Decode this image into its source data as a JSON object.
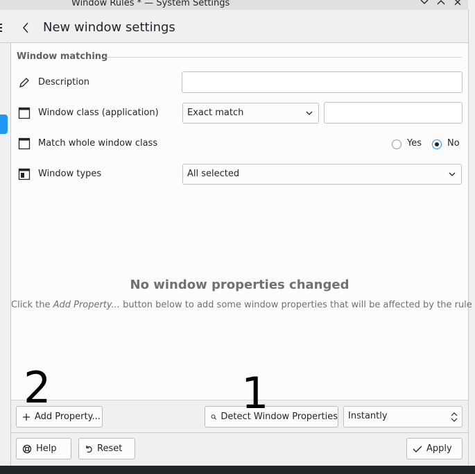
{
  "window": {
    "title": "Window Rules * — System Settings",
    "minimize_icon": "chevron-down-icon",
    "maximize_icon": "chevron-up-icon",
    "close_icon": "close-icon"
  },
  "header": {
    "title": "New window settings"
  },
  "section": {
    "heading": "Window matching"
  },
  "rows": {
    "description": {
      "label": "Description",
      "value": ""
    },
    "window_class": {
      "label": "Window class (application)",
      "match_type": "Exact match",
      "value": ""
    },
    "whole_class": {
      "label": "Match whole window class",
      "yes": "Yes",
      "no": "No",
      "selected": "No"
    },
    "window_types": {
      "label": "Window types",
      "value": "All selected"
    }
  },
  "empty_state": {
    "title": "No window properties changed",
    "desc_before": "Click the ",
    "desc_em": "Add Property...",
    "desc_after": " button below to add some window properties that will be affected by the rule"
  },
  "footer": {
    "add_property": "Add Property...",
    "detect": "Detect Window Properties",
    "delay": "Instantly"
  },
  "bottom": {
    "help": "Help",
    "reset": "Reset",
    "apply": "Apply"
  },
  "annotations": {
    "first": "1",
    "second": "2"
  },
  "colors": {
    "accent": "#2196f3",
    "background": "#eff0f1",
    "content": "#fcfcfc"
  }
}
